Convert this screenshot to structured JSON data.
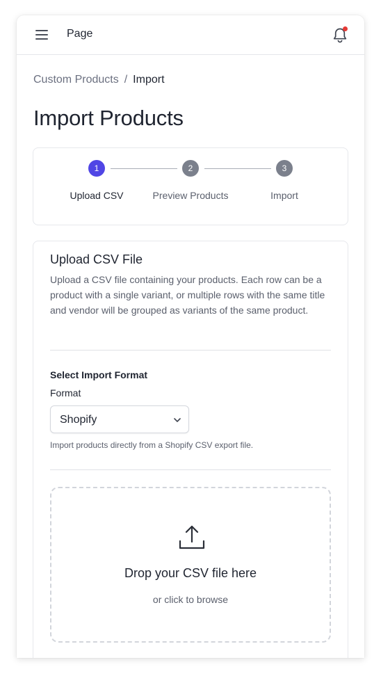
{
  "header": {
    "page_label": "Page"
  },
  "breadcrumb": {
    "parent": "Custom Products",
    "separator": "/",
    "current": "Import"
  },
  "title": "Import Products",
  "stepper": {
    "steps": [
      {
        "number": "1",
        "label": "Upload CSV",
        "state": "active"
      },
      {
        "number": "2",
        "label": "Preview Products",
        "state": "inactive"
      },
      {
        "number": "3",
        "label": "Import",
        "state": "inactive"
      }
    ],
    "colors": {
      "active": "#5046e5",
      "inactive": "#7b808c"
    }
  },
  "upload_card": {
    "title": "Upload CSV File",
    "description": "Upload a CSV file containing your products. Each row can be a product with a single variant, or multiple rows with the same title and vendor will be grouped as variants of the same product.",
    "format_section_label": "Select Import Format",
    "format_label": "Format",
    "format_value": "Shopify",
    "format_help": "Import products directly from a Shopify CSV export file.",
    "dropzone": {
      "title": "Drop your CSV file here",
      "subtitle": "or click to browse"
    }
  },
  "icons": {
    "menu": "hamburger-menu-icon",
    "bell": "bell-icon",
    "chevron": "chevron-down-icon",
    "upload": "upload-icon"
  },
  "notification_dot_color": "#e53935"
}
